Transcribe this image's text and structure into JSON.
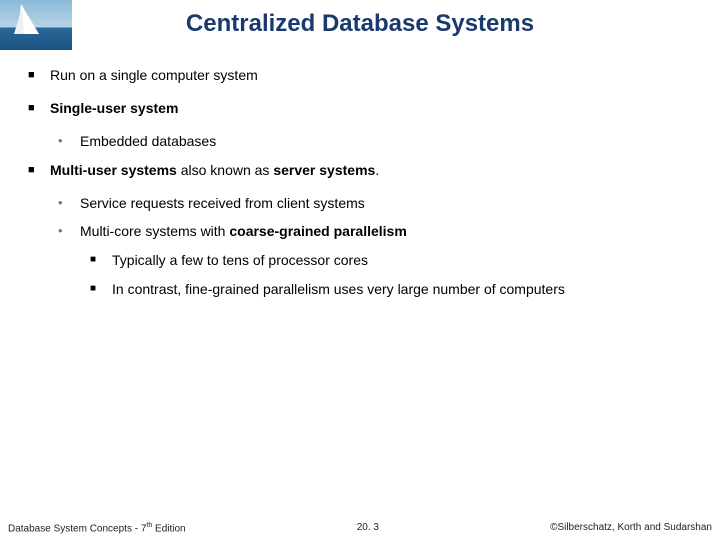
{
  "title": "Centralized Database Systems",
  "bullets": {
    "b1": "Run on a single computer system",
    "b2_bold": "Single-user system",
    "b2a": "Embedded databases",
    "b3_pre": "Multi-user systems",
    "b3_mid": " also known as ",
    "b3_bold2": "server systems",
    "b3_post": ".",
    "b3a": "Service requests received from client systems",
    "b3b_pre": "Multi-core systems with ",
    "b3b_bold": "coarse-grained parallelism",
    "b3b1": "Typically a few to tens of processor cores",
    "b3b2": "In contrast, fine-grained parallelism uses very large number of computers"
  },
  "footer": {
    "left_pre": "Database System Concepts - 7",
    "left_sup": "th",
    "left_post": " Edition",
    "center": "20. 3",
    "right": "©Silberschatz, Korth and Sudarshan"
  }
}
